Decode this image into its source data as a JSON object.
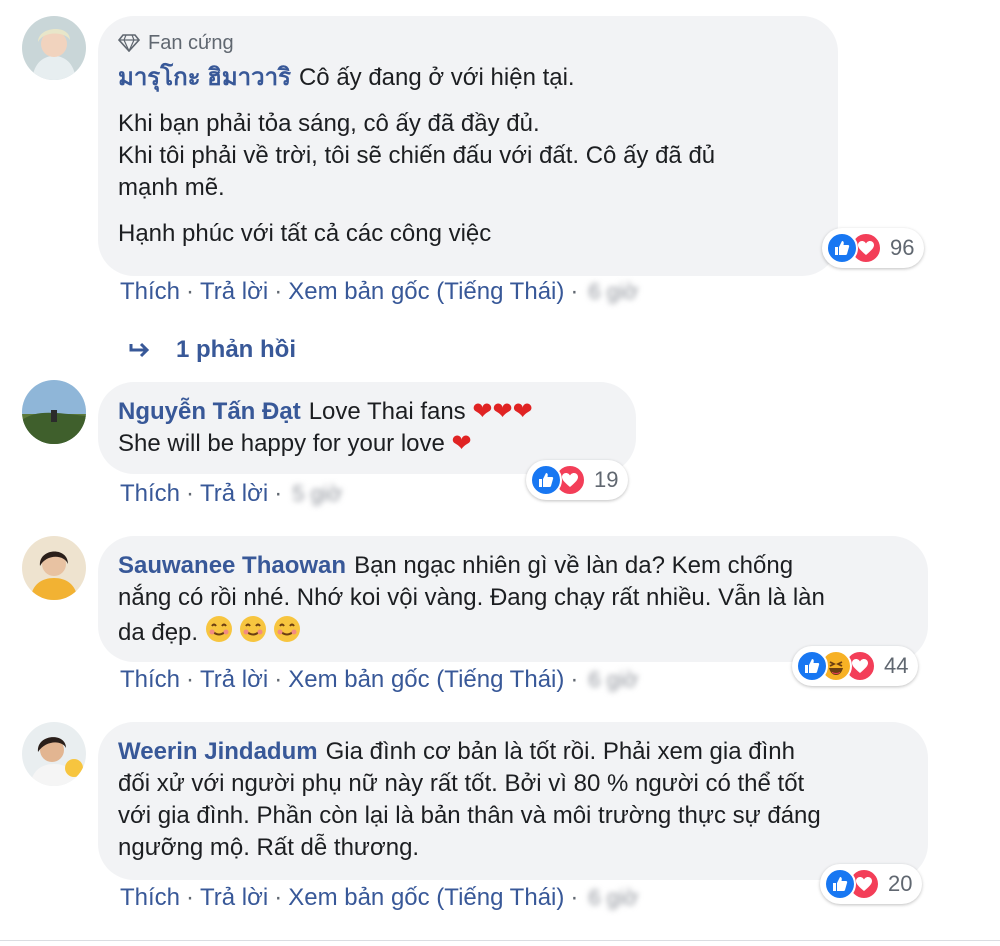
{
  "comments": [
    {
      "badge": "Fan cứng",
      "author": "มารุโกะ ฮิมาวาริ",
      "lines": [
        "Cô ấy đang ở với hiện tại."
      ],
      "para2": [
        "Khi bạn phải tỏa sáng, cô ấy đã đầy đủ.",
        "Khi tôi phải về trời, tôi sẽ chiến đấu với đất. Cô ấy đã đủ",
        "mạnh mẽ."
      ],
      "para3": "Hạnh phúc với tất cả các công việc",
      "reactions": [
        "like",
        "love"
      ],
      "reaction_count": "96",
      "actions": {
        "like": "Thích",
        "reply": "Trả lời",
        "translate": "Xem bản gốc (Tiếng Thái)",
        "time": "6 giờ"
      }
    },
    {
      "author": "Nguyễn Tấn Đạt",
      "line1": "Love Thai fans",
      "line2": "She will be happy for your love",
      "reactions": [
        "like",
        "love"
      ],
      "reaction_count": "19",
      "actions": {
        "like": "Thích",
        "reply": "Trả lời",
        "time": "5 giờ"
      }
    },
    {
      "author": "Sauwanee Thaowan",
      "line1": "Bạn ngạc nhiên gì về làn da? Kem chống",
      "line2": "nắng có rồi nhé. Nhớ koi vội vàng. Đang chạy rất nhiều. Vẫn là làn",
      "line3": "da đẹp.",
      "reactions": [
        "like",
        "haha",
        "love"
      ],
      "reaction_count": "44",
      "actions": {
        "like": "Thích",
        "reply": "Trả lời",
        "translate": "Xem bản gốc (Tiếng Thái)",
        "time": "6 giờ"
      }
    },
    {
      "author": "Weerin Jindadum",
      "line1": "Gia đình cơ bản là tốt rồi. Phải xem gia đình",
      "line2": "đối xử với người phụ nữ này rất tốt. Bởi vì 80 % người có thể tốt",
      "line3": "với gia đình. Phần còn lại là bản thân và môi trường thực sự đáng",
      "line4": "ngưỡng mộ. Rất dễ thương.",
      "reactions": [
        "like",
        "love"
      ],
      "reaction_count": "20",
      "actions": {
        "like": "Thích",
        "reply": "Trả lời",
        "translate": "Xem bản gốc (Tiếng Thái)",
        "time": "6 giờ"
      }
    }
  ],
  "replies_link": "1 phản hồi",
  "colors": {
    "link": "#385898",
    "bubble": "#f2f3f5",
    "like": "#1877f2",
    "love": "#f33e58",
    "haha": "#f7b125"
  }
}
